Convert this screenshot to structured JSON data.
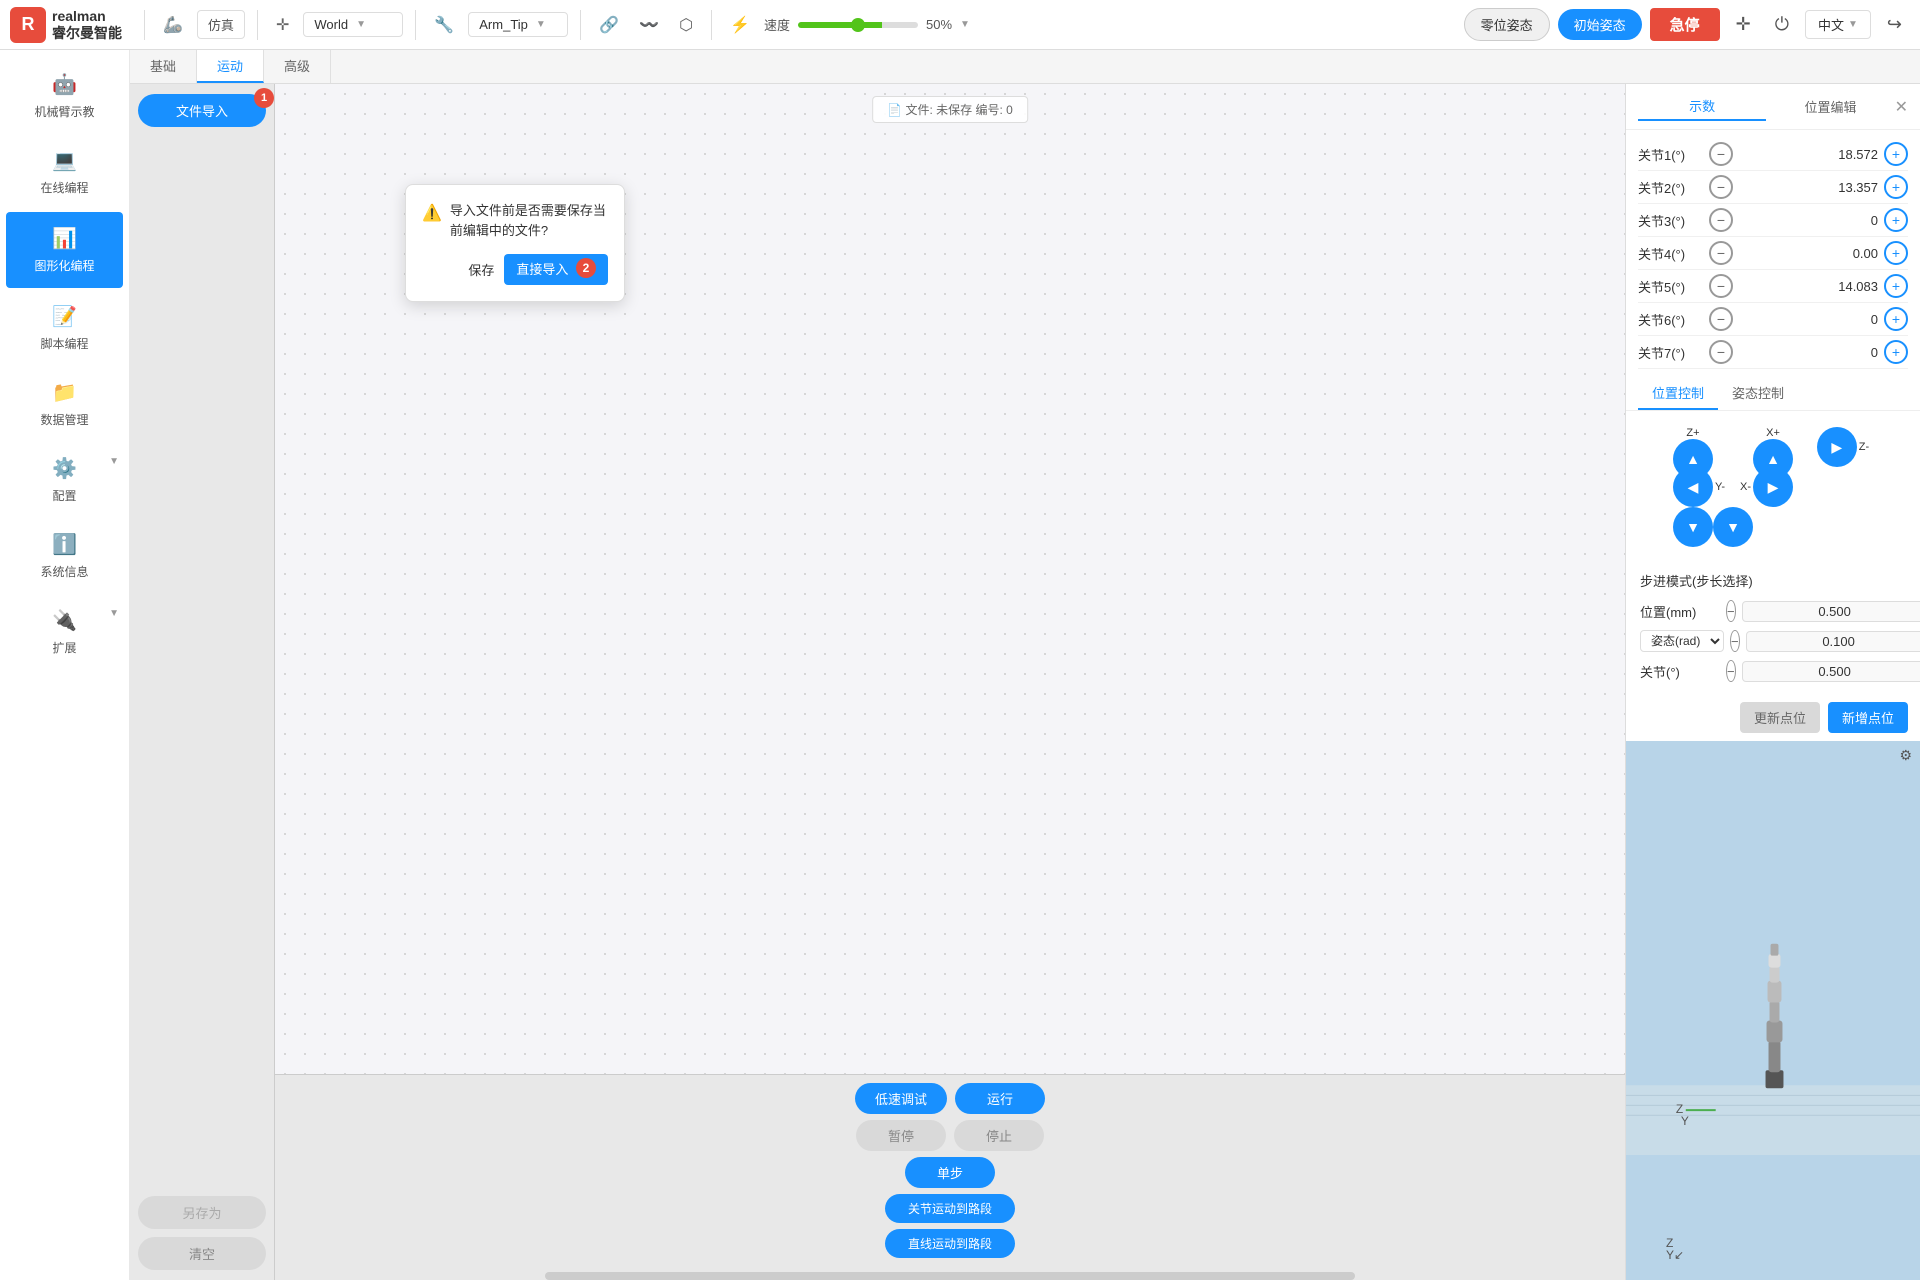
{
  "app": {
    "logo_text_line1": "睿尔曼智能",
    "logo_emoji": "🤖"
  },
  "topbar": {
    "simulate_label": "仿真",
    "world_label": "World",
    "arm_tip_label": "Arm_Tip",
    "speed_label": "速度",
    "speed_value": "50%",
    "zero_pose_label": "零位姿态",
    "init_pose_label": "初始姿态",
    "estop_label": "急停",
    "lang_label": "中文"
  },
  "sidebar": {
    "items": [
      {
        "id": "mechanical-teaching",
        "icon": "🤖",
        "label": "机械臂示教"
      },
      {
        "id": "online-programming",
        "icon": "💻",
        "label": "在线编程"
      },
      {
        "id": "graphical-programming",
        "icon": "📊",
        "label": "图形化编程",
        "active": true
      },
      {
        "id": "script-programming",
        "icon": "📝",
        "label": "脚本编程"
      },
      {
        "id": "data-management",
        "icon": "📁",
        "label": "数据管理"
      },
      {
        "id": "settings",
        "icon": "⚙️",
        "label": "配置",
        "has_expand": true
      },
      {
        "id": "system-info",
        "icon": "ℹ️",
        "label": "系统信息"
      },
      {
        "id": "extensions",
        "icon": "🔌",
        "label": "扩展",
        "has_expand": true
      }
    ]
  },
  "tabs": {
    "items": [
      {
        "id": "basic",
        "label": "基础",
        "active": false
      },
      {
        "id": "motion",
        "label": "运动",
        "active": true
      },
      {
        "id": "advanced",
        "label": "高级",
        "active": false
      }
    ]
  },
  "left_panel": {
    "import_btn": "文件导入",
    "save_as_btn": "另存为",
    "clear_btn": "清空",
    "badge_1": "1",
    "badge_2": "2"
  },
  "canvas": {
    "file_status": "📄 文件: 未保存  编号: 0"
  },
  "popup": {
    "warning_text": "导入文件前是否需要保存当前编辑中的文件?",
    "save_btn": "保存",
    "direct_import_btn": "直接导入"
  },
  "bottom_controls": {
    "slow_debug": "低速调试",
    "run": "运行",
    "pause": "暂停",
    "stop": "停止",
    "step": "单步",
    "joint_motion": "关节运动到路段",
    "linear_motion": "直线运动到路段"
  },
  "right_panel": {
    "tab_show": "示数",
    "tab_position_edit": "位置编辑",
    "joints": [
      {
        "label": "关节1(°)",
        "value": "18.572"
      },
      {
        "label": "关节2(°)",
        "value": "13.357"
      },
      {
        "label": "关节3(°)",
        "value": "0"
      },
      {
        "label": "关节4(°)",
        "value": "0.00"
      },
      {
        "label": "关节5(°)",
        "value": "14.083"
      },
      {
        "label": "关节6(°)",
        "value": "0"
      },
      {
        "label": "关节7(°)",
        "value": "0"
      }
    ],
    "ctrl_tabs": {
      "position_ctrl": "位置控制",
      "pose_ctrl": "姿态控制"
    },
    "step_mode_label": "步进模式(步长选择)",
    "steps": [
      {
        "label": "位置(mm)",
        "value": "0.500"
      },
      {
        "label": "姿态(rad)",
        "value": "0.100",
        "has_select": true,
        "select_val": "姿态(rad)"
      },
      {
        "label": "关节(°)",
        "value": "0.500"
      }
    ],
    "update_point_btn": "更新点位",
    "add_point_btn": "新增点位"
  }
}
